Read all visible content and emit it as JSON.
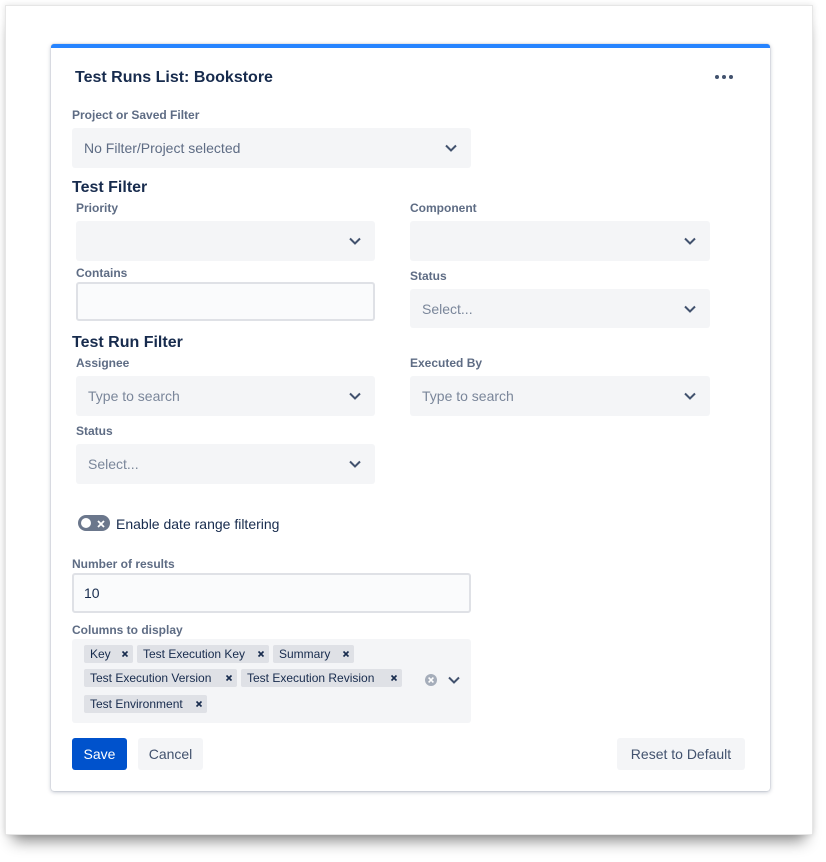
{
  "card": {
    "title": "Test Runs List: Bookstore",
    "more_icon": "more-horizontal-icon"
  },
  "project_filter": {
    "label": "Project or Saved Filter",
    "value": "No Filter/Project selected"
  },
  "test_filter": {
    "title": "Test Filter",
    "priority": {
      "label": "Priority",
      "value": ""
    },
    "component": {
      "label": "Component",
      "value": ""
    },
    "contains": {
      "label": "Contains",
      "value": ""
    },
    "status": {
      "label": "Status",
      "placeholder": "Select..."
    }
  },
  "test_run_filter": {
    "title": "Test Run Filter",
    "assignee": {
      "label": "Assignee",
      "placeholder": "Type to search"
    },
    "executed_by": {
      "label": "Executed By",
      "placeholder": "Type to search"
    },
    "status": {
      "label": "Status",
      "placeholder": "Select..."
    }
  },
  "date_range": {
    "label": "Enable date range filtering",
    "enabled": false
  },
  "number_of_results": {
    "label": "Number of results",
    "value": "10"
  },
  "columns": {
    "label": "Columns to display",
    "tags": [
      "Key",
      "Test Execution Key",
      "Summary",
      "Test Execution Version",
      "Test Execution Revision",
      "Test Environment"
    ]
  },
  "actions": {
    "save": "Save",
    "cancel": "Cancel",
    "reset": "Reset to Default"
  },
  "colors": {
    "primary": "#0052cc",
    "accent_border": "#2684ff",
    "field_bg": "#f4f5f7",
    "text": "#172b4d"
  }
}
